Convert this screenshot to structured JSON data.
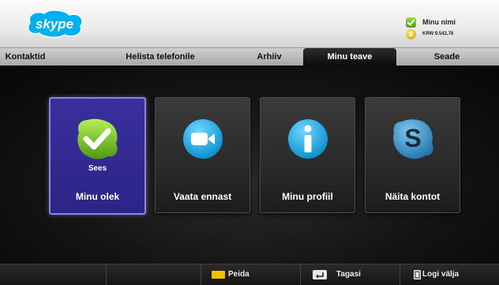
{
  "app": {
    "logo_text": "skype",
    "user_name": "Minu nimi",
    "credit": "KRW 9.542,78",
    "credit_symbol": "S",
    "brand_color": "#00aff0"
  },
  "tabs": [
    {
      "label": "Kontaktid",
      "active": false
    },
    {
      "label": "Helista telefonile",
      "active": false
    },
    {
      "label": "Arhiiv",
      "active": false
    },
    {
      "label": "Minu teave",
      "active": true
    },
    {
      "label": "Seade",
      "active": false
    }
  ],
  "tiles": [
    {
      "label": "Minu olek",
      "sublabel": "Sees",
      "icon": "online-status-check-icon",
      "selected": true
    },
    {
      "label": "Vaata ennast",
      "sublabel": "",
      "icon": "video-camera-icon",
      "selected": false
    },
    {
      "label": "Minu profiil",
      "sublabel": "",
      "icon": "info-icon",
      "selected": false
    },
    {
      "label": "Näita kontot",
      "sublabel": "",
      "icon": "skype-s-icon",
      "selected": false
    }
  ],
  "footer": {
    "hide_label": "Peida",
    "back_label": "Tagasi",
    "logout_label": "Logi välja",
    "hide_key_color": "#f2c200"
  }
}
